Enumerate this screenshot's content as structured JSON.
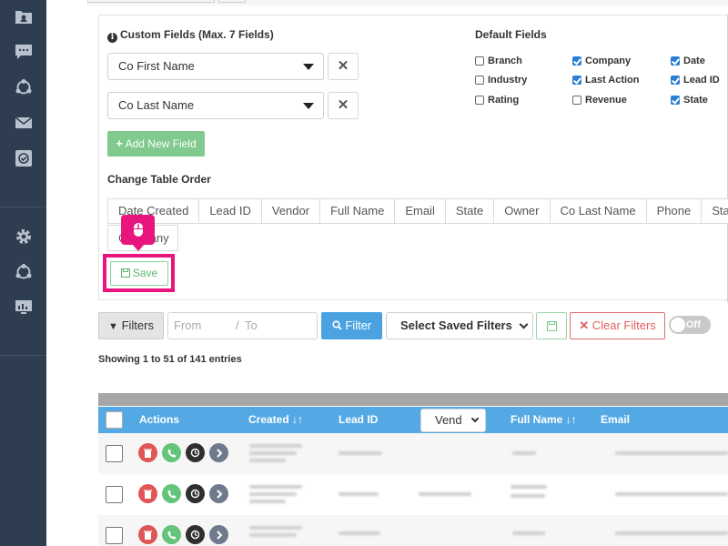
{
  "custom_fields": {
    "title": "Custom Fields (Max. 7 Fields)",
    "fields": [
      {
        "value": "Co First Name",
        "remove_label": "✕"
      },
      {
        "value": "Co Last Name",
        "remove_label": "✕"
      }
    ],
    "add_button_label": "Add New Field"
  },
  "default_fields": {
    "title": "Default Fields",
    "items": [
      {
        "label": "Branch",
        "checked": false
      },
      {
        "label": "Company",
        "checked": true
      },
      {
        "label": "Date",
        "checked": true
      },
      {
        "label": "Industry",
        "checked": false
      },
      {
        "label": "Last Action",
        "checked": true
      },
      {
        "label": "Lead ID",
        "checked": true
      },
      {
        "label": "Rating",
        "checked": false
      },
      {
        "label": "Revenue",
        "checked": false
      },
      {
        "label": "State",
        "checked": true
      }
    ]
  },
  "table_order": {
    "title": "Change Table Order",
    "columns": [
      "Date Created",
      "Lead ID",
      "Vendor",
      "Full Name",
      "Email",
      "State",
      "Owner",
      "Co Last Name",
      "Phone",
      "Statu"
    ],
    "second_row": "Company"
  },
  "save_button_label": "Save",
  "filter_bar": {
    "filters_label": "Filters",
    "from_placeholder": "From",
    "to_placeholder": "To",
    "filter_button_label": "Filter",
    "saved_filters_label": "Select Saved Filters",
    "clear_filters_label": "Clear Filters",
    "toggle_label": "Off"
  },
  "showing_text": "Showing 1 to 51 of 141 entries",
  "table": {
    "headers": {
      "actions": "Actions",
      "created": "Created ↓↑",
      "lead_id": "Lead ID",
      "vendor_select": "Vend",
      "full_name": "Full Name ↓↑",
      "email": "Email"
    }
  },
  "colors": {
    "sidebar": "#2e3e50",
    "accent_blue": "#54a9e4",
    "highlight_pink": "#e8157e",
    "success_green": "#7fca8c",
    "danger_red": "#e05555"
  },
  "icons": {
    "sidebar_top": [
      "contacts-folder-icon",
      "chat-icon",
      "share-network-icon",
      "mail-icon",
      "check-task-icon"
    ],
    "sidebar_bottom": [
      "settings-gear-icon",
      "share-network-icon",
      "monitor-chart-icon"
    ]
  }
}
